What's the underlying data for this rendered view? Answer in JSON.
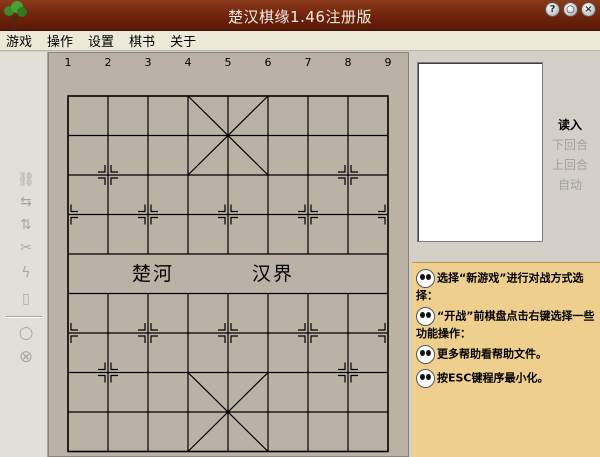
{
  "window": {
    "title": "楚汉棋缘1.46注册版",
    "controls": [
      "?",
      "○",
      "×"
    ]
  },
  "menu": [
    "游戏",
    "操作",
    "设置",
    "棋书",
    "关于"
  ],
  "board": {
    "columns": [
      "1",
      "2",
      "3",
      "4",
      "5",
      "6",
      "7",
      "8",
      "9"
    ],
    "river_left": "楚河",
    "river_right": "汉界"
  },
  "toolbar_icons": [
    "link-icon",
    "swap-icon",
    "up-down-icon",
    "scissors-icon",
    "lightning-icon",
    "page-icon",
    "circle-icon",
    "chess-piece-icon"
  ],
  "controls": {
    "read": "读入",
    "next": "下回合",
    "prev": "上回合",
    "auto": "自动"
  },
  "help": [
    "选择“新游戏”进行对战方式选择：",
    "“开战”前棋盘点击右键选择一些功能操作：",
    "更多帮助看帮助文件。",
    "按ESC键程序最小化。"
  ]
}
